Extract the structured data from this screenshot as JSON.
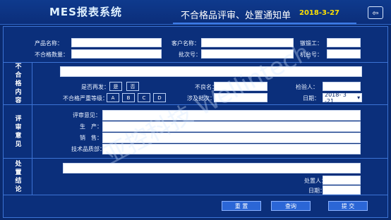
{
  "header": {
    "app_title": "MES报表系统",
    "form_title": "不合格品评审、处置通知单",
    "date": "2018-3-27",
    "exit_icon": "exit-icon"
  },
  "top": {
    "product_name_label": "产品名称：",
    "customer_name_label": "客户名称：",
    "worker_label": "镦锻工：",
    "nonconf_qty_label": "不合格数量：",
    "batch_label": "批次号：",
    "machine_label": "机台号："
  },
  "nonconformity": {
    "side_label": "不合格内容",
    "recurrence_label": "是否再发：",
    "yes": "是",
    "no": "否",
    "nonconf_label": "不良名：",
    "inspector_label": "检验人：",
    "severity_label": "不合格严重等级：",
    "levels": [
      "A",
      "B",
      "C",
      "D"
    ],
    "batch_involved_label": "涉及批次：",
    "date_label": "日期：",
    "date_value": "2018- 3 -21"
  },
  "review": {
    "side_label": "评审意见",
    "comments_label": "评审意见：",
    "production_label": "生　产：",
    "sales_label": "销　售：",
    "tech_quality_label": "技术品质部："
  },
  "disposal": {
    "side_label": "处置结论",
    "handler_label": "处置人：",
    "date_label": "日期："
  },
  "actions": {
    "reset": "重 置",
    "query": "查询",
    "submit": "提 交"
  },
  "watermark": "亚控科技 Wellintech"
}
